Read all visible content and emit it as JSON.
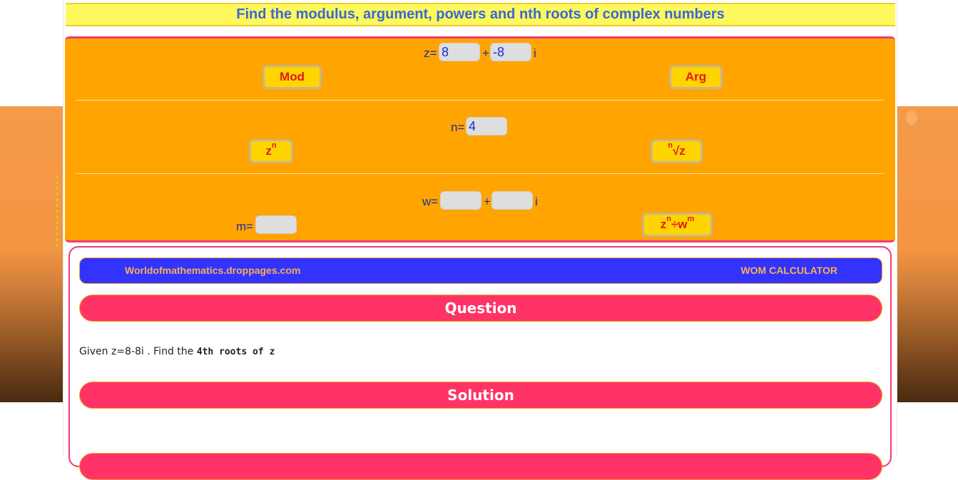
{
  "title": "Find the modulus, argument, powers and nth roots of complex numbers",
  "calculator": {
    "z_label": "z=",
    "z_real": "8",
    "plus_sign": "+",
    "z_imag": "-8",
    "i_suffix": "i",
    "mod_button": "Mod",
    "arg_button": "Arg",
    "n_label": "n=",
    "n_value": "4",
    "zn_button_base": "z",
    "zn_button_sup": "n",
    "root_button_sup": "n",
    "root_button_base": "√z",
    "w_label": "w=",
    "w_real": "",
    "w_imag": "",
    "m_label": "m=",
    "m_value": "",
    "div_button_base1": "z",
    "div_button_sup1": "n",
    "div_button_mid": "÷w",
    "div_button_sup2": "m"
  },
  "result_panel": {
    "site_name": "Worldofmathematics.droppages.com",
    "calculator_name": "WOM CALCULATOR",
    "question_heading": "Question",
    "question_prefix": "Given z=8-8i . Find the ",
    "question_bold": "4th roots of z",
    "solution_heading": "Solution"
  },
  "colors": {
    "title_bar": "#fdf85c",
    "title_text": "#3a67d6",
    "calculator_bg": "#ffa400",
    "button_bg": "#ffd400",
    "button_text": "#e41818",
    "accent_border": "#ef3c70",
    "wom_bar": "#3333ff",
    "heading_pill": "#ff3366"
  }
}
